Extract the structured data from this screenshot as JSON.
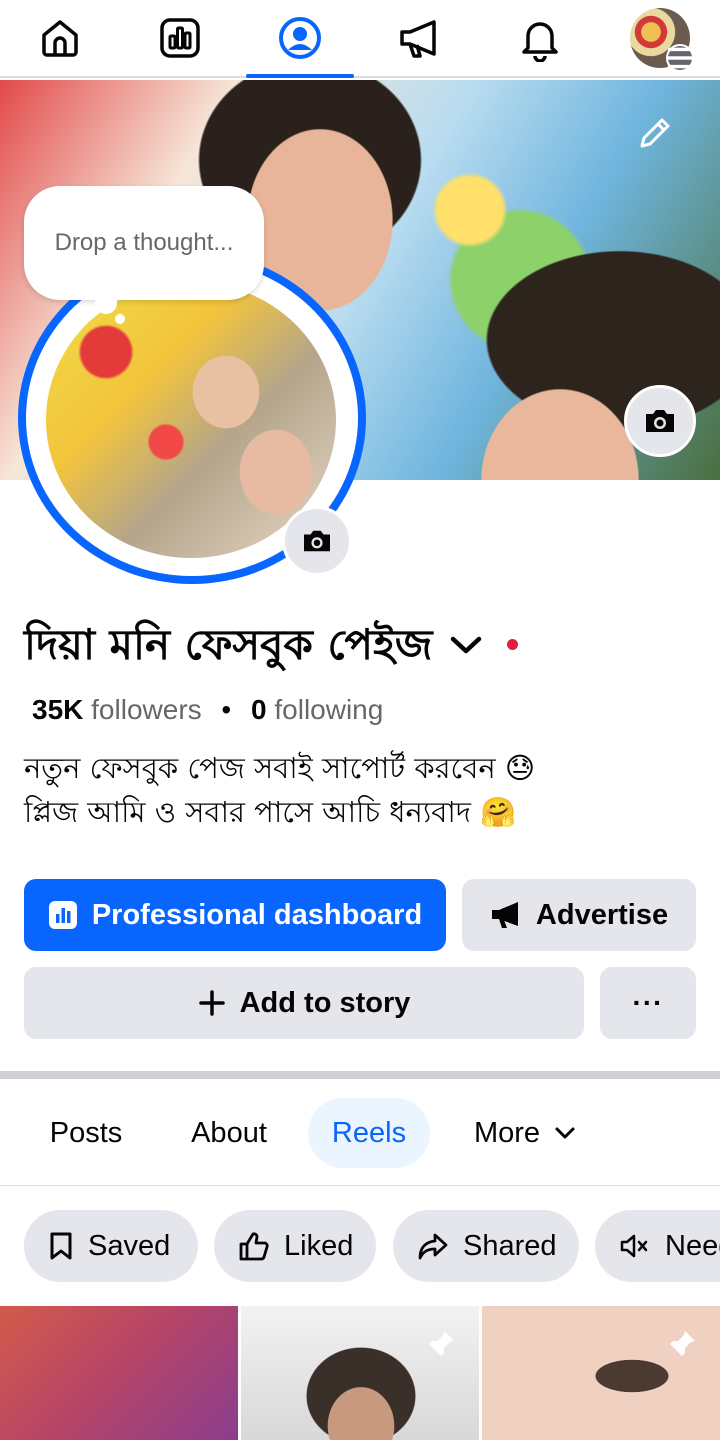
{
  "nav": {
    "items": [
      {
        "name": "home"
      },
      {
        "name": "dashboard"
      },
      {
        "name": "profile",
        "active": true
      },
      {
        "name": "ads"
      },
      {
        "name": "notifications"
      },
      {
        "name": "menu"
      }
    ]
  },
  "thought": {
    "placeholder": "Drop a thought..."
  },
  "profile": {
    "name": "দিয়া মনি ফেসবুক পেইজ",
    "followers_count": "35K",
    "followers_label": "followers",
    "separator": "•",
    "following_count": "0",
    "following_label": "following",
    "bio_line1": "নতুন ফেসবুক  পেজ সবাই সাপোর্ট করবেন 😓",
    "bio_line2": "প্লিজ আমি ও সবার পাসে আচি ধন্যবাদ 🤗"
  },
  "actions": {
    "professional_dashboard": "Professional dashboard",
    "advertise": "Advertise",
    "add_to_story": "Add to story",
    "more": "···"
  },
  "tabs": [
    {
      "label": "Posts"
    },
    {
      "label": "About"
    },
    {
      "label": "Reels",
      "active": true
    },
    {
      "label": "More"
    }
  ],
  "filters": [
    {
      "label": "Saved",
      "icon": "bookmark-icon"
    },
    {
      "label": "Liked",
      "icon": "thumbs-up-icon"
    },
    {
      "label": "Shared",
      "icon": "share-icon"
    },
    {
      "label": "Need",
      "icon": "muted-speaker-icon"
    }
  ],
  "colors": {
    "primary": "#0866ff",
    "secondary_bg": "#e4e6eb",
    "muted_text": "#65676b",
    "live_dot": "#e41e3f"
  }
}
